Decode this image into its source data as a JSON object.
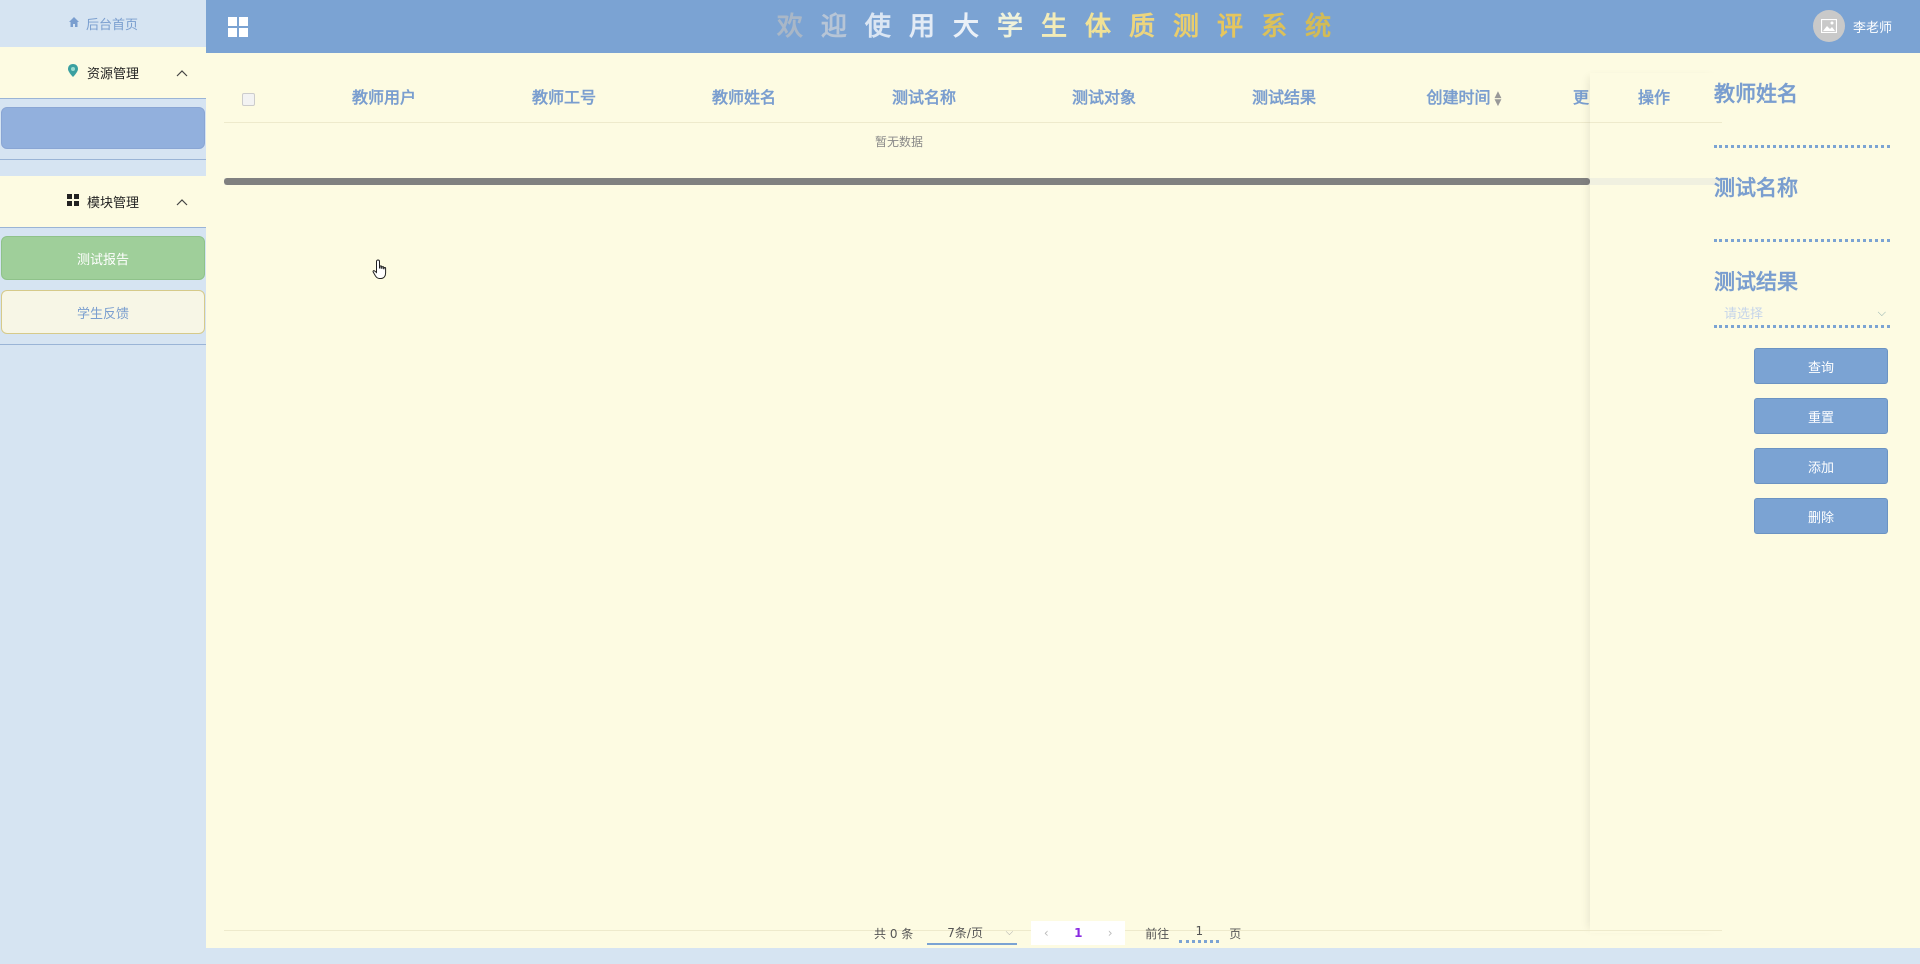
{
  "header": {
    "title_chars": [
      {
        "ch": "欢",
        "color": "#a9b7c7"
      },
      {
        "ch": "迎",
        "color": "#b7c5d6"
      },
      {
        "ch": "使",
        "color": "#dbe6f3"
      },
      {
        "ch": "用",
        "color": "#e3ebf5"
      },
      {
        "ch": "大",
        "color": "#eaf0f7"
      },
      {
        "ch": "学",
        "color": "#f0f2da"
      },
      {
        "ch": "生",
        "color": "#f3ecb8"
      },
      {
        "ch": "体",
        "color": "#f1e296"
      },
      {
        "ch": "质",
        "color": "#ecd57e"
      },
      {
        "ch": "测",
        "color": "#e9cd6c"
      },
      {
        "ch": "评",
        "color": "#e6c65d"
      },
      {
        "ch": "系",
        "color": "#dcc15a"
      },
      {
        "ch": "统",
        "color": "#d2bb57"
      }
    ],
    "user_name": "李老师"
  },
  "sidebar": {
    "home_label": "后台首页",
    "groups": [
      {
        "label": "资源管理",
        "icon": "map-pin-icon"
      },
      {
        "label": "模块管理",
        "icon": "grid-icon"
      }
    ],
    "resource_items": [
      ""
    ],
    "module_items": [
      {
        "label": "测试报告"
      },
      {
        "label": "学生反馈"
      }
    ]
  },
  "table": {
    "columns": [
      "教师用户",
      "教师工号",
      "教师姓名",
      "测试名称",
      "测试对象",
      "测试结果",
      "创建时间",
      "更",
      "操作"
    ],
    "empty_text": "暂无数据",
    "rows": []
  },
  "pagination": {
    "total": "共 0 条",
    "page_size": "7条/页",
    "current_page": "1",
    "goto_label": "前往",
    "goto_value": "1",
    "goto_suffix": "页"
  },
  "search_panel": {
    "teacher_name_label": "教师姓名",
    "test_name_label": "测试名称",
    "test_result_label": "测试结果",
    "test_result_placeholder": "请选择",
    "buttons": {
      "query": "查询",
      "reset": "重置",
      "add": "添加",
      "delete": "删除"
    }
  },
  "colors": {
    "header_bg": "#7ba3d3",
    "main_bg": "#fdfbe2",
    "sidebar_bg": "#d6e4f2",
    "active_item": "#9fcf9a",
    "accent_text": "#7a9ecf"
  }
}
